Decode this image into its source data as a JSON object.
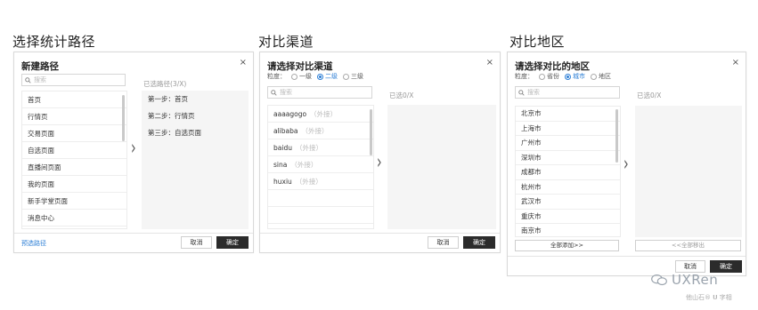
{
  "sections": {
    "path_title": "选择统计路径",
    "channel_title": "对比渠道",
    "region_title": "对比地区"
  },
  "dialog1": {
    "title": "新建路径",
    "close": "×",
    "search_placeholder": "搜索",
    "items": [
      "首页",
      "行情页",
      "交易页面",
      "自选页面",
      "直播间页面",
      "我的页面",
      "新手学堂页面",
      "消息中心"
    ],
    "selected_title": "已选路径(3/X)",
    "selected": [
      "第一步：首页",
      "第二步：行情页",
      "第三步：自选页面"
    ],
    "preset_link": "预选路径",
    "cancel": "取消",
    "confirm": "确定"
  },
  "dialog2": {
    "title": "请选择对比渠道",
    "close": "×",
    "granularity_label": "粒度：",
    "options": [
      "一级",
      "二级",
      "三级"
    ],
    "selected_option": "二级",
    "search_placeholder": "搜索",
    "items": [
      {
        "name": "aaaagogo",
        "tag": "（外接）"
      },
      {
        "name": "alibaba",
        "tag": "（外接）"
      },
      {
        "name": "baidu",
        "tag": "（外接）"
      },
      {
        "name": "sina",
        "tag": "（外接）"
      },
      {
        "name": "huxiu",
        "tag": "（外接）"
      }
    ],
    "selected_title": "已选0/X",
    "cancel": "取消",
    "confirm": "确定"
  },
  "dialog3": {
    "title": "请选择对比的地区",
    "close": "×",
    "granularity_label": "粒度：",
    "options": [
      "省份",
      "城市",
      "地区"
    ],
    "selected_option": "城市",
    "search_placeholder": "搜索",
    "items": [
      "北京市",
      "上海市",
      "广州市",
      "深圳市",
      "成都市",
      "杭州市",
      "武汉市",
      "重庆市",
      "南京市"
    ],
    "selected_title": "已选0/X",
    "add_all": "全部添加>>",
    "remove_all": "<<全部移出",
    "cancel": "取消",
    "confirm": "确定"
  },
  "watermark": {
    "brand": "UXRen",
    "credit": "他山石® 𝐔 字相"
  }
}
